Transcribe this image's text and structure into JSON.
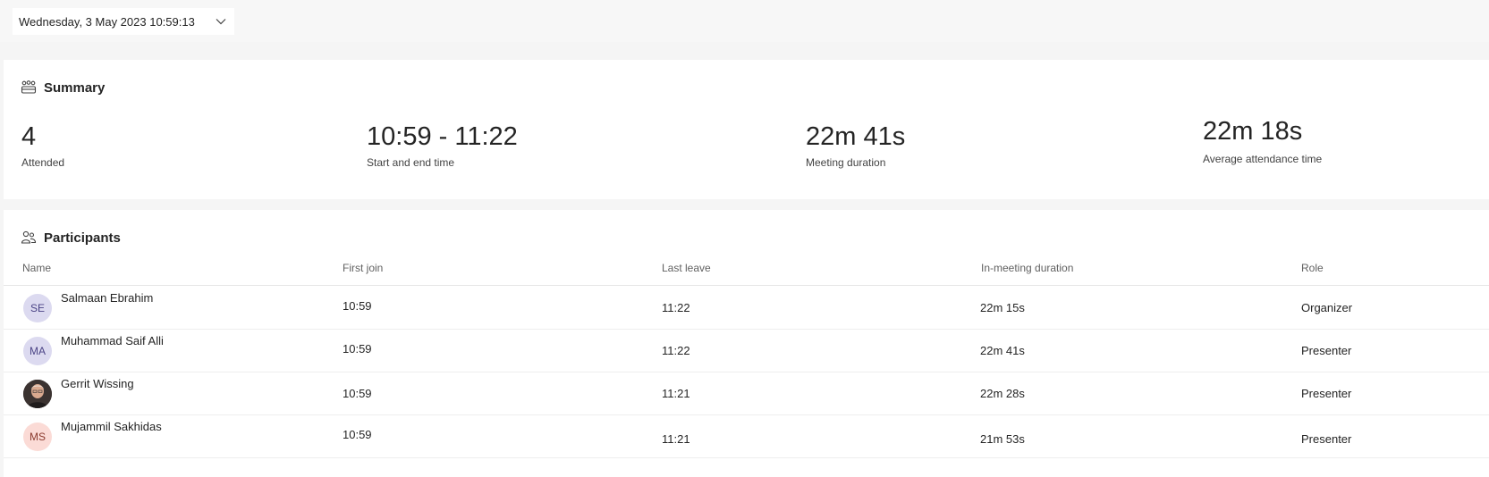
{
  "header": {
    "date_label": "Wednesday, 3 May 2023 10:59:13"
  },
  "summary": {
    "title": "Summary",
    "stats": [
      {
        "value": "4",
        "label": "Attended"
      },
      {
        "value": "10:59 - 11:22",
        "label": "Start and end time"
      },
      {
        "value": "22m 41s",
        "label": "Meeting duration"
      },
      {
        "value": "22m 18s",
        "label": "Average attendance time"
      }
    ]
  },
  "participants": {
    "title": "Participants",
    "columns": [
      "Name",
      "First join",
      "Last leave",
      "In-meeting duration",
      "Role"
    ],
    "rows": [
      {
        "initials": "SE",
        "name": "Salmaan Ebrahim",
        "first_join": "10:59",
        "last_leave": "11:22",
        "duration": "22m 15s",
        "role": "Organizer"
      },
      {
        "initials": "MA",
        "name": "Muhammad Saif Alli",
        "first_join": "10:59",
        "last_leave": "11:22",
        "duration": "22m 41s",
        "role": "Presenter"
      },
      {
        "initials": "",
        "name": "Gerrit Wissing",
        "first_join": "10:59",
        "last_leave": "11:21",
        "duration": "22m 28s",
        "role": "Presenter"
      },
      {
        "initials": "MS",
        "name": "Mujammil Sakhidas",
        "first_join": "10:59",
        "last_leave": "11:21",
        "duration": "21m 53s",
        "role": "Presenter"
      }
    ]
  },
  "colors": {
    "accent_purple_bg": "#dcdaf0",
    "accent_pink_bg": "#fbdbd6",
    "card_bg": "#ffffff",
    "page_bg": "#f5f5f5"
  }
}
